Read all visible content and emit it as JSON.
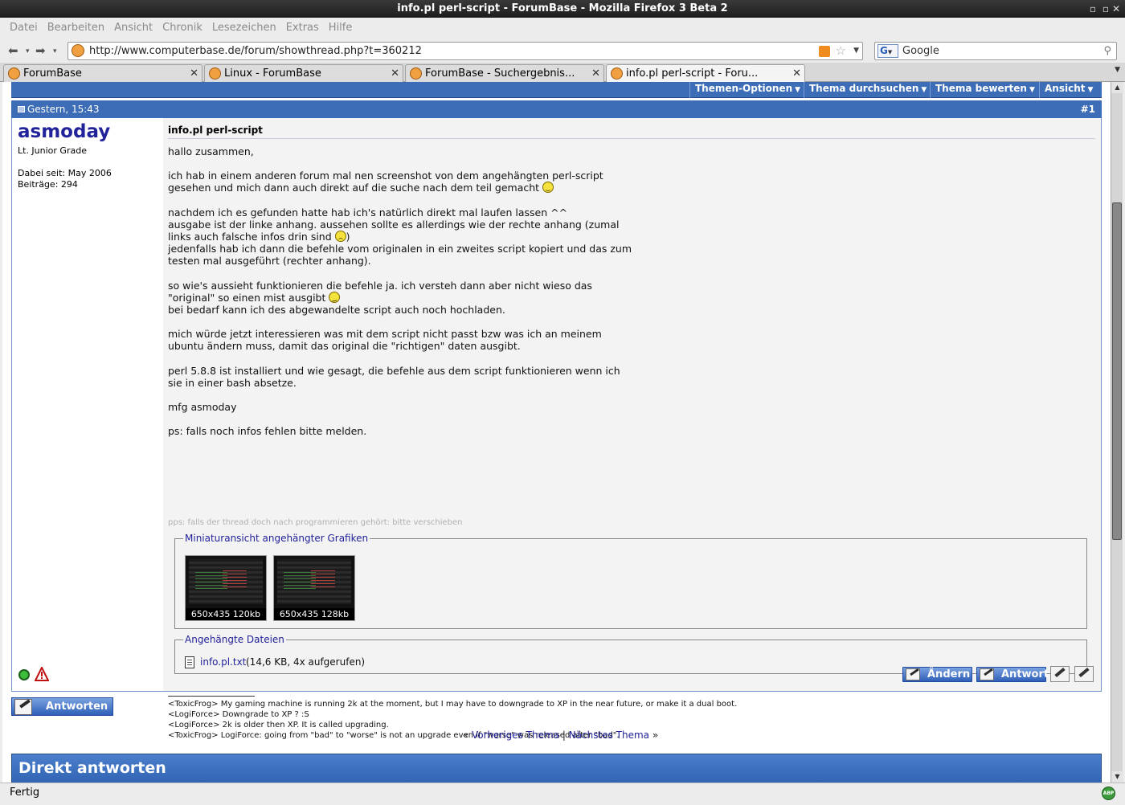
{
  "window": {
    "title": "info.pl perl-script - ForumBase - Mozilla Firefox 3 Beta 2"
  },
  "menu": [
    "Datei",
    "Bearbeiten",
    "Ansicht",
    "Chronik",
    "Lesezeichen",
    "Extras",
    "Hilfe"
  ],
  "nav": {
    "url": "http://www.computerbase.de/forum/showthread.php?t=360212",
    "search_engine_letter": "G",
    "search_placeholder": "Google"
  },
  "tabs": [
    {
      "label": "ForumBase",
      "active": false
    },
    {
      "label": "Linux - ForumBase",
      "active": false
    },
    {
      "label": "ForumBase - Suchergebnis...",
      "active": false
    },
    {
      "label": "info.pl perl-script - Foru...",
      "active": true
    }
  ],
  "thread_options": [
    "Themen-Optionen",
    "Thema durchsuchen",
    "Thema bewerten",
    "Ansicht"
  ],
  "post": {
    "date": "Gestern, 15:43",
    "number": "#1",
    "user": {
      "name": "asmoday",
      "title": "Lt. Junior Grade",
      "joined": "Dabei seit: May 2006",
      "posts": "Beiträge: 294"
    },
    "title": "info.pl perl-script",
    "lines": {
      "greeting": "hallo zusammen,",
      "p1a": "ich hab in einem anderen forum mal nen screenshot von dem angehängten perl-script",
      "p1b": "gesehen und mich dann auch direkt auf die suche nach dem teil gemacht ",
      "p2a": "nachdem ich es gefunden hatte hab ich's natürlich direkt mal laufen lassen ^^",
      "p2b": "ausgabe ist der linke anhang. aussehen sollte es allerdings wie der rechte anhang (zumal",
      "p2c_pre": "links auch falsche infos drin sind ",
      "p2c_post": ")",
      "p2d": "jedenfalls hab ich dann die befehle vom originalen in ein zweites script kopiert und das zum",
      "p2e": "testen mal ausgeführt (rechter anhang).",
      "p3a": "so wie's aussieht funktionieren die befehle ja. ich versteh dann aber nicht wieso das",
      "p3b": "\"original\" so einen mist ausgibt ",
      "p3c": "bei bedarf kann ich des abgewandelte script auch noch hochladen.",
      "p4a": "mich würde jetzt interessieren was mit dem script nicht passt bzw was ich an meinem",
      "p4b": "ubuntu ändern muss, damit das original die \"richtigen\" daten ausgibt.",
      "p5a": "perl 5.8.8 ist installiert und wie gesagt, die befehle aus dem script funktionieren wenn ich",
      "p5b": "sie in einer bash absetze.",
      "p6": "mfg asmoday",
      "p7": "ps: falls noch infos fehlen bitte melden.",
      "pps": "pps: falls der thread doch nach programmieren gehört: bitte verschieben"
    },
    "thumbs_legend": "Miniaturansicht angehängter Grafiken",
    "thumbs": [
      "650x435 120kb",
      "650x435 128kb"
    ],
    "files_legend": "Angehängte Dateien",
    "file": {
      "name": "info.pl.txt",
      "info": "(14,6 KB, 4x aufgerufen)"
    },
    "signature": [
      "<ToxicFrog> My gaming machine is running 2k at the moment, but I may have to downgrade to XP in the near future, or make it a dual boot.",
      "<LogiForce> Downgrade to XP ? :S",
      "<LogiForce> 2k is older then XP. It is called upgrading.",
      "<ToxicFrog> LogiForce: going from \"bad\" to \"worse\" is not an upgrade even if \"worse\" was released after \"bad\"."
    ],
    "buttons": {
      "edit": "Ändern",
      "reply": "Antwort"
    }
  },
  "reply_button": "Antworten",
  "thread_nav": {
    "prev": "Vorheriges Thema",
    "sep": "|",
    "next": "Nächstes Thema",
    "left": "«",
    "right": "»"
  },
  "direct_reply": "Direkt antworten",
  "status": "Fertig",
  "adblock_label": "ABP"
}
